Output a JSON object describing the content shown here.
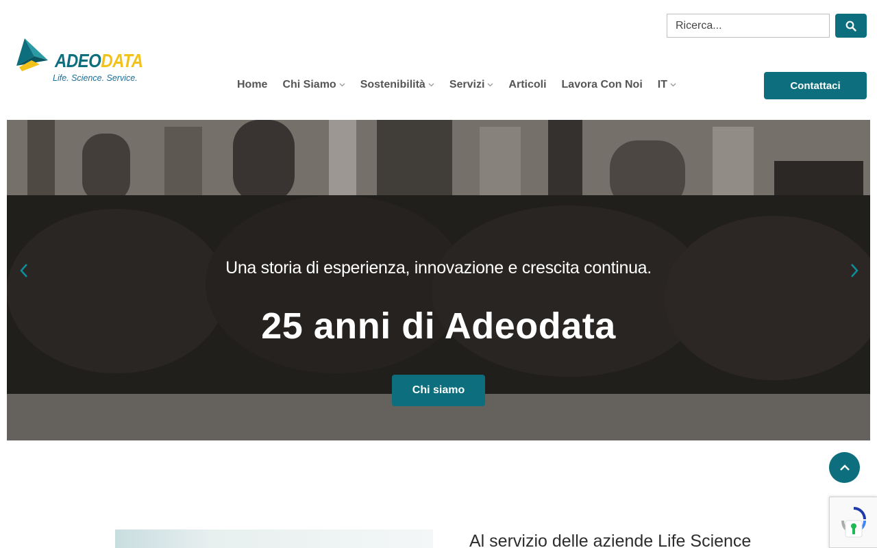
{
  "brand": {
    "name_part1": "ADEO",
    "name_part2": "DATA",
    "tagline": "Life. Science. Service.",
    "primary_color": "#0d6f7d",
    "accent_color": "#f2c21b"
  },
  "search": {
    "placeholder": "Ricerca...",
    "button_icon": "search-icon"
  },
  "nav": {
    "items": [
      {
        "label": "Home",
        "has_dropdown": false
      },
      {
        "label": "Chi Siamo",
        "has_dropdown": true
      },
      {
        "label": "Sostenibilità",
        "has_dropdown": true
      },
      {
        "label": "Servizi",
        "has_dropdown": true
      },
      {
        "label": "Articoli",
        "has_dropdown": false
      },
      {
        "label": "Lavora Con Noi",
        "has_dropdown": false
      },
      {
        "label": "IT",
        "has_dropdown": true
      }
    ],
    "contact_label": "Contattaci"
  },
  "hero": {
    "subtitle": "Una storia di esperienza, innovazione e crescita continua.",
    "title": "25 anni di Adeodata",
    "button_label": "Chi siamo",
    "prev_icon": "chevron-left-icon",
    "next_icon": "chevron-right-icon"
  },
  "section": {
    "title": "Al servizio delle aziende Life Science"
  },
  "floating": {
    "back_to_top_icon": "chevron-up-icon",
    "recaptcha_icon": "recaptcha-icon"
  }
}
